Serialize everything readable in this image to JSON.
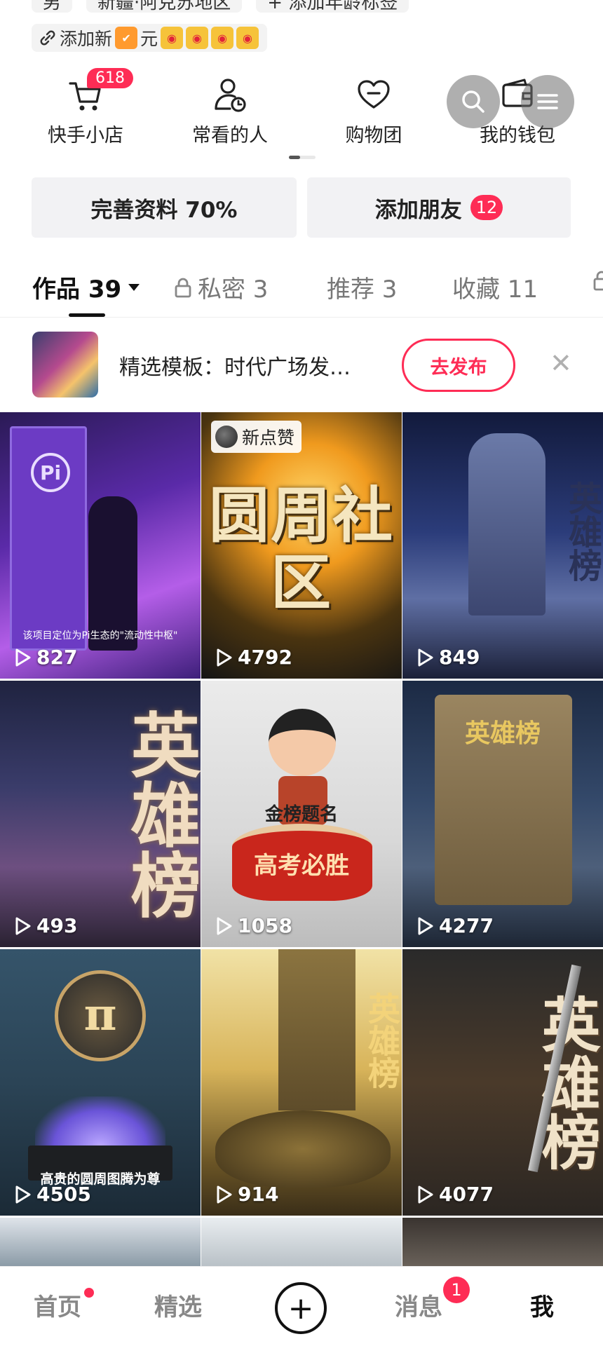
{
  "top_tags": {
    "row1": [
      "男",
      "新疆·阿克苏地区",
      "+ 添加年龄标签"
    ],
    "row2_label": "添加新",
    "row2_label_tail": "元"
  },
  "quick_entries": [
    {
      "label": "快手小店",
      "badge": "618",
      "icon": "cart-icon"
    },
    {
      "label": "常看的人",
      "icon": "person-clock-icon"
    },
    {
      "label": "购物团",
      "icon": "heart-group-icon"
    },
    {
      "label": "我的钱包",
      "icon": "wallet-icon"
    }
  ],
  "profile_buttons": {
    "complete_label": "完善资料 70%",
    "add_friends_label": "添加朋友",
    "add_friends_badge": "12"
  },
  "tabs": [
    {
      "label": "作品 39",
      "active": true
    },
    {
      "label": "私密 3",
      "locked": true
    },
    {
      "label": "推荐 3"
    },
    {
      "label": "收藏 11"
    }
  ],
  "promo": {
    "text": "精选模板：时代广场发…",
    "button": "去发布"
  },
  "grid": [
    {
      "views": "827",
      "title": "",
      "caption": "该项目定位为Pi生态的\"流动性中枢\"",
      "like_tag": ""
    },
    {
      "views": "4792",
      "title": "圆周社区",
      "caption": "",
      "like_tag": "新点赞"
    },
    {
      "views": "849",
      "title": "英雄榜",
      "caption": "",
      "like_tag": ""
    },
    {
      "views": "493",
      "title": "英雄榜",
      "caption": "",
      "like_tag": ""
    },
    {
      "views": "1058",
      "title": "高考必胜",
      "caption": "金榜题名",
      "like_tag": ""
    },
    {
      "views": "4277",
      "title": "英雄榜",
      "caption": "",
      "like_tag": ""
    },
    {
      "views": "4505",
      "title": "π",
      "caption": "高贵的圆周图腾为尊",
      "like_tag": ""
    },
    {
      "views": "914",
      "title": "英雄榜",
      "caption": "",
      "like_tag": ""
    },
    {
      "views": "4077",
      "title": "英雄榜",
      "caption": "",
      "like_tag": ""
    }
  ],
  "bottom_nav": {
    "home": "首页",
    "featured": "精选",
    "messages": "消息",
    "messages_badge": "1",
    "me": "我"
  },
  "colors": {
    "accent": "#fe2c55",
    "button_bg": "#f2f2f4"
  }
}
